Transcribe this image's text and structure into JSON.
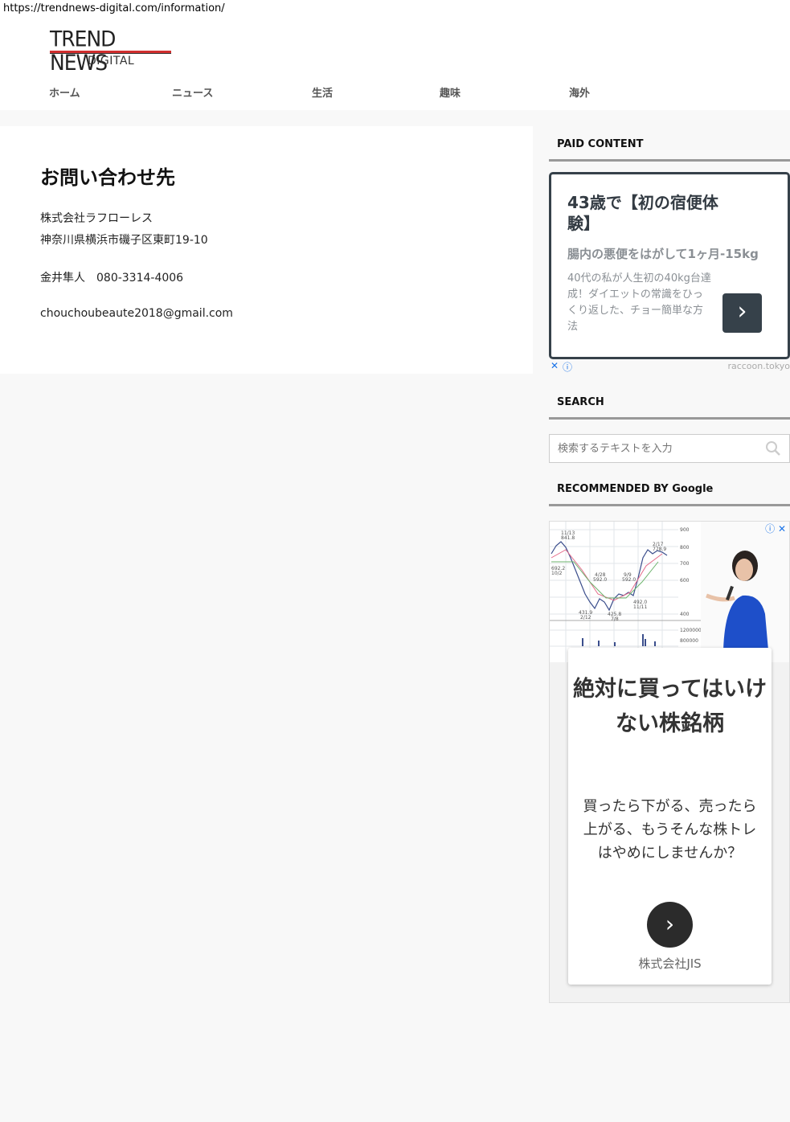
{
  "browser": {
    "url": "https://trendnews-digital.com/information/"
  },
  "header": {
    "logo_line1": "TREND NEWS",
    "logo_line2": "DIGITAL",
    "accent_color": "#d12f2f"
  },
  "nav": {
    "items": [
      {
        "label": "ホーム"
      },
      {
        "label": "ニュース"
      },
      {
        "label": "生活"
      },
      {
        "label": "趣味"
      },
      {
        "label": "海外"
      }
    ]
  },
  "main": {
    "title": "お問い合わせ先",
    "company": "株式会社ラフローレス",
    "address": "神奈川県横浜市磯子区東町19-10",
    "contact": "金井隼人　080-3314-4006",
    "email": "chouchoubeaute2018@gmail.com"
  },
  "sidebar": {
    "paid_title": "PAID CONTENT",
    "ad1": {
      "headline": "43歳で【初の宿便体験】",
      "subhead": "腸内の悪便をはがして1ヶ月-15kg",
      "description": "40代の私が人生初の40kg台達成！ダイエットの常識をひっくり返した、チョー簡単な方法",
      "button_icon": "chevron-right-icon",
      "close_icon": "close-icon",
      "info_icon": "info-icon",
      "source": "raccoon.tokyo"
    },
    "search_title": "SEARCH",
    "search": {
      "placeholder": "検索するテキストを入力",
      "icon": "search-icon"
    },
    "recommended_title": "RECOMMENDED BY Google",
    "ad2": {
      "chart_labels": [
        "11/13",
        "841.8",
        "692.2",
        "10/2",
        "431.9",
        "2/12",
        "425.8",
        "7/8",
        "9/9",
        "592.0",
        "4/28",
        "592.0",
        "492.0",
        "11/11",
        "2/17",
        "778.9",
        "900",
        "800",
        "700",
        "600",
        "400",
        "1200000",
        "800000"
      ],
      "headline": "絶対に買ってはいけない株銘柄",
      "description": "買ったら下がる、売ったら上がる、もうそんな株トレはやめにしませんか？",
      "button_icon": "chevron-right-icon",
      "advertiser": "株式会社JIS"
    }
  }
}
